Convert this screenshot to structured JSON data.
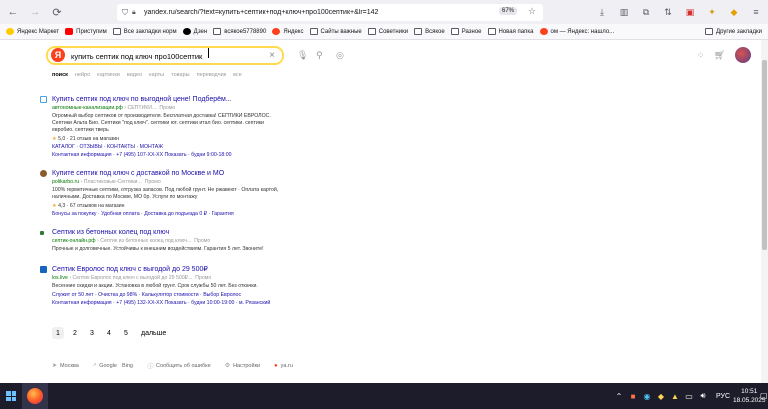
{
  "browser": {
    "url": "yandex.ru/search/?text=купить+септик+под+ключ+про100септик+&lr=142",
    "zoom": "67%"
  },
  "bookmarks": [
    {
      "label": "Яндекс Маркет",
      "icon": "yandex-market-icon",
      "type": "site"
    },
    {
      "label": "Приступим",
      "icon": "youtube-icon",
      "type": "site"
    },
    {
      "label": "Все закладки норм",
      "icon": "folder-icon",
      "type": "folder"
    },
    {
      "label": "Дзен",
      "icon": "dzen-icon",
      "type": "site"
    },
    {
      "label": "всякое5778890",
      "icon": "folder-icon",
      "type": "folder"
    },
    {
      "label": "Яндекс",
      "icon": "yandex-icon",
      "type": "site"
    },
    {
      "label": "Сайты важные",
      "icon": "folder-icon",
      "type": "folder"
    },
    {
      "label": "Советники",
      "icon": "folder-icon",
      "type": "folder"
    },
    {
      "label": "Всякое",
      "icon": "folder-icon",
      "type": "folder"
    },
    {
      "label": "Разное",
      "icon": "folder-icon",
      "type": "folder"
    },
    {
      "label": "Новая папка",
      "icon": "folder-icon",
      "type": "folder"
    },
    {
      "label": "ом — Яндекс: нашло...",
      "icon": "yandex-icon",
      "type": "site"
    }
  ],
  "bookmarks_other": "Другие закладки",
  "search": {
    "logo": "Я",
    "query": "купить септик под ключ про100септик"
  },
  "tabs": [
    "поиск",
    "нейро",
    "картинки",
    "видео",
    "карты",
    "товары",
    "переводчик",
    "все"
  ],
  "results": [
    {
      "title": "Купить септик под ключ по выгодной цене! Подберём...",
      "favicon_color": "#4aa3df",
      "url": "автономные-канализации.рф",
      "path": "› СЕПТИКИ...",
      "promo": "Промо",
      "text": "Огромный выбор септиков от производителя. Бесплатная доставка!  СЕПТИКИ ЕВРОЛОС. Септики Альта Био. Септики \"под ключ\". септики ют. септики итал био. септики. септики евробио. септики тверь",
      "rating": "5,0 · 21 отзыв на магазин",
      "links": "КАТАЛОГ · ОТЗЫВЫ · КОНТАКТЫ · МОНТАЖ",
      "contact": "Контактная информация · +7 (495) 107-ХХ-ХХ Показать · будни 9:00-18:00"
    },
    {
      "title": "Купите септик под ключ с доставкой по Москве и МО",
      "favicon_color": "#8b5a2b",
      "url": "polikarbo.ru",
      "path": "› Пластиковые-Септики...",
      "promo": "Промо",
      "text": "100% герметичные септики, отгрузка запасов. Под любой грунт. Не ржавеют · Оплата картой, наличными. Доставка по Москве, МО 0р. Услуги по монтажу",
      "rating": "4,3 · 67 отзывов на магазин",
      "links": "Бонусы за покупку · Удобная оплата · Доставка до подъезда 0 ₽ · Гарантия",
      "contact": ""
    },
    {
      "title": "Септик из бетонных колец под ключ",
      "favicon_color": "#2e7d32",
      "url": "септик-онлайн.рф",
      "path": "› Септик из бетонных колец под ключ...",
      "promo": "Промо",
      "text": "Прочные и долговечные. Устойчивы к внешним воздействиям. Гарантия 5 лет. Звоните!",
      "rating": "",
      "links": "",
      "contact": ""
    },
    {
      "title": "Септик Евролос под ключ с выгодой до 29 500₽",
      "favicon_color": "#1565c0",
      "url": "los.live",
      "path": "› Септик Евролос под ключ с выгодой до 29 500₽...",
      "promo": "Промо",
      "text": "Весенние скидки и акции. Установка в любой грунт. Срок службы 50 лет. Без откачки.",
      "rating": "",
      "links": "Служит от 50 лет · Очистка до 98% · Калькулятор стоимости · Выбор Евролос",
      "contact": "Контактная информация · +7 (495) 132-ХХ-ХХ Показать · будни 10:00-19:00 · м. Рязанский"
    }
  ],
  "pager": {
    "pages": [
      "1",
      "2",
      "3",
      "4",
      "5"
    ],
    "current": "1",
    "next": "дальше"
  },
  "footer": [
    {
      "label": "Москва",
      "icon": "location-icon"
    },
    {
      "label": "Google",
      "icon": "search-icon"
    },
    {
      "label": "Bing",
      "icon": ""
    },
    {
      "label": "Сообщить об ошибке",
      "icon": "info-icon"
    },
    {
      "label": "Настройки",
      "icon": "gear-icon"
    },
    {
      "label": "ya.ru",
      "icon": "yandex-icon"
    }
  ],
  "taskbar": {
    "lang": "РУС",
    "time": "10:51",
    "date": "18.05.2025"
  }
}
